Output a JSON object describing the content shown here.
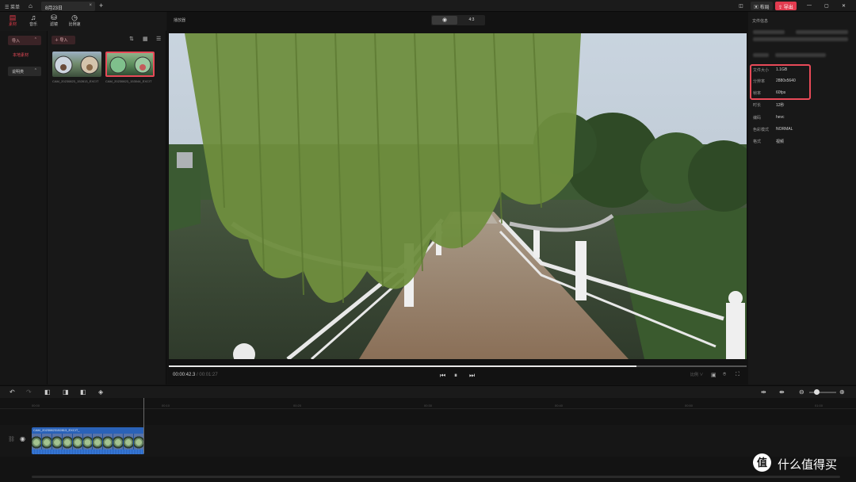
{
  "titlebar": {
    "menu_label": "菜单",
    "tab_title": "8月23日",
    "export_label": "导出",
    "layout_label": "布局",
    "min": "—",
    "max": "▢",
    "close": "✕"
  },
  "tools": [
    {
      "icon": "media-icon",
      "label": "素材"
    },
    {
      "icon": "music-icon",
      "label": "音乐"
    },
    {
      "icon": "filter-icon",
      "label": "滤镜"
    },
    {
      "icon": "timer-icon",
      "label": "比例速"
    }
  ],
  "categories": {
    "import_label": "导入",
    "local_label": "本地素材",
    "group_label": "说明类"
  },
  "media": {
    "import_button": "导入",
    "items": [
      {
        "caption": "CAM_20230823_152813_EXCIT"
      },
      {
        "caption": "CAM_20230823_153044_EXCIT"
      }
    ]
  },
  "preview": {
    "title": "播放器",
    "seg_left": "◉",
    "seg_right": "4:3",
    "current_time": "00:00:42.3",
    "total_time": "/ 00:01:27",
    "progress": 0.81,
    "ratio_label": "比例 ∨"
  },
  "properties": {
    "title": "文件信息",
    "rows": [
      {
        "key": "文件大小",
        "value": "1.1GB"
      },
      {
        "key": "分辨率",
        "value": "2880x5640"
      },
      {
        "key": "帧率",
        "value": "60fps"
      },
      {
        "key": "时长",
        "value": "12秒"
      },
      {
        "key": "编码",
        "value": "hevc"
      },
      {
        "key": "色彩模式",
        "value": "NORMAL"
      },
      {
        "key": "格式",
        "value": "视频"
      }
    ]
  },
  "timeline": {
    "ticks": [
      "00:00",
      "00:10",
      "00:20",
      "00:30",
      "00:40",
      "00:50",
      "01:00"
    ],
    "clip_name": "CAM_20230823152813_EXCIT_"
  },
  "watermark": {
    "logo": "值",
    "text": "什么值得买"
  },
  "colors": {
    "accent": "#e84a58",
    "clip": "#2a62b8"
  }
}
